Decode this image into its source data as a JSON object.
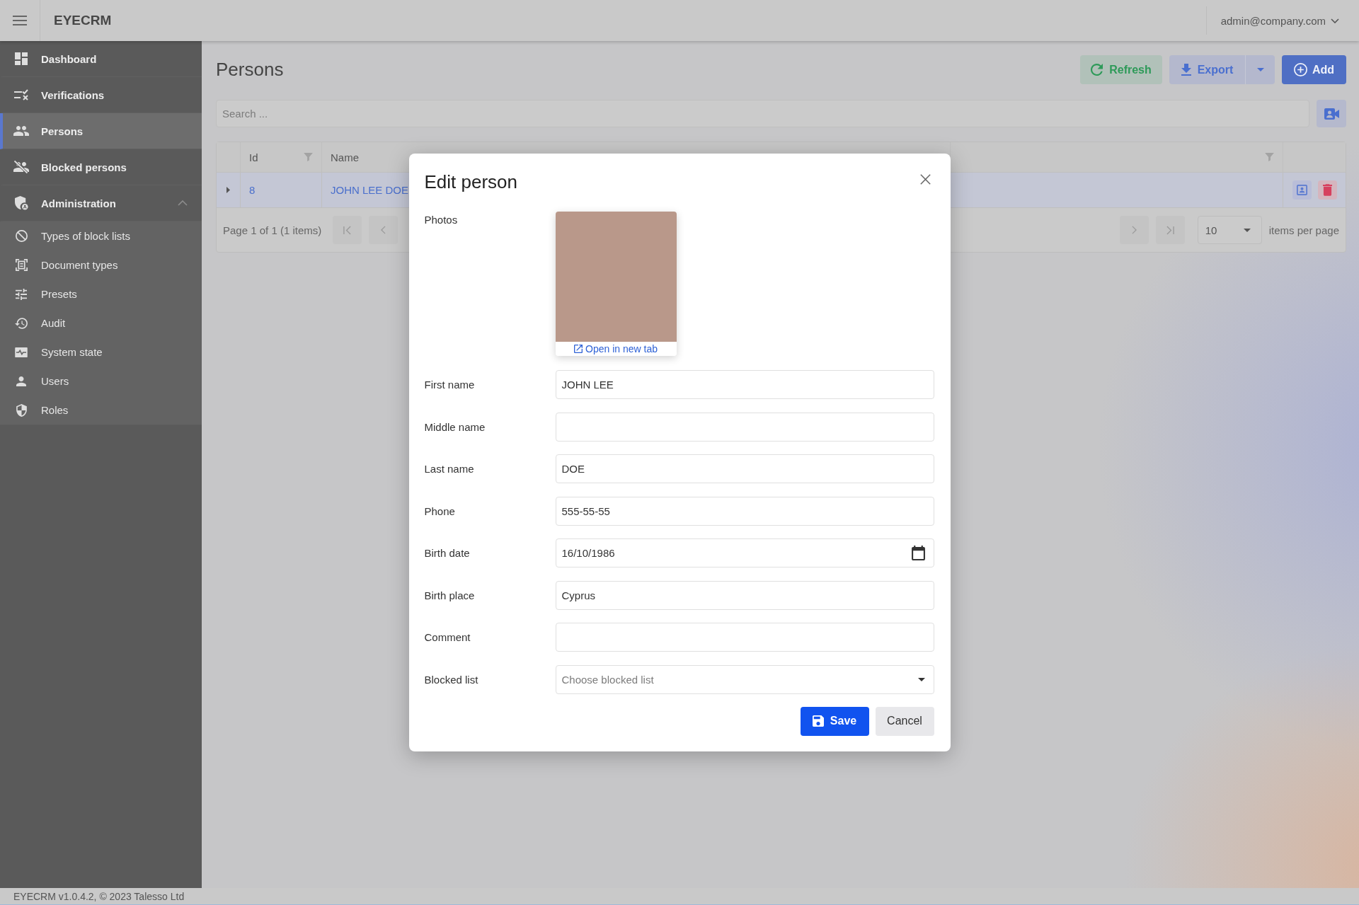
{
  "header": {
    "app_title": "EYECRM",
    "user_menu": "admin@company.com"
  },
  "sidebar": {
    "items": [
      {
        "label": "Dashboard",
        "selected": false
      },
      {
        "label": "Verifications",
        "selected": false
      },
      {
        "label": "Persons",
        "selected": true
      },
      {
        "label": "Blocked persons",
        "selected": false
      },
      {
        "label": "Administration",
        "selected": false,
        "expanded": true,
        "children": [
          {
            "label": "Types of block lists",
            "selected": false
          },
          {
            "label": "Document types",
            "selected": false
          },
          {
            "label": "Presets",
            "selected": false
          },
          {
            "label": "Audit",
            "selected": false
          },
          {
            "label": "System state",
            "selected": false
          },
          {
            "label": "Users",
            "selected": false
          },
          {
            "label": "Roles",
            "selected": false
          }
        ]
      }
    ]
  },
  "page": {
    "title": "Persons",
    "actions": [
      {
        "label": "Refresh",
        "kind": "refresh"
      },
      {
        "label": "Export",
        "kind": "export"
      },
      {
        "label": "Add",
        "kind": "add"
      }
    ],
    "search": {
      "placeholder": "Search ..."
    }
  },
  "table": {
    "columns": [
      {
        "label": "Id",
        "filter": true
      },
      {
        "label": "Name",
        "filter": false
      },
      {
        "filter": true
      }
    ],
    "rows": [
      {
        "expanded": false,
        "cells": [
          "8",
          "JOHN LEE DOE"
        ]
      }
    ],
    "pagination": {
      "summary": "Page 1 of 1 (1 items)",
      "page_size": "10",
      "page_size_label": "items per page"
    }
  },
  "dialog": {
    "title": "Edit person",
    "fields": [
      {
        "kind": "photos",
        "label": "Photos",
        "link": "Open in new tab"
      },
      {
        "kind": "text",
        "label": "First name",
        "value": "JOHN LEE"
      },
      {
        "kind": "text",
        "label": "Middle name"
      },
      {
        "kind": "text",
        "label": "Last name",
        "value": "DOE"
      },
      {
        "kind": "text",
        "label": "Phone",
        "value": "555-55-55"
      },
      {
        "kind": "date",
        "label": "Birth date",
        "value": "16/10/1986"
      },
      {
        "kind": "text",
        "label": "Birth place",
        "value": "Cyprus"
      },
      {
        "kind": "text",
        "label": "Comment"
      },
      {
        "kind": "select",
        "label": "Blocked list",
        "placeholder": "Choose blocked list"
      }
    ],
    "buttons": [
      {
        "label": "Save",
        "kind": "primary"
      },
      {
        "label": "Cancel",
        "kind": "secondary"
      }
    ]
  },
  "footer": {
    "text": "EYECRM v1.0.4.2, © 2023 Talesso Ltd"
  }
}
